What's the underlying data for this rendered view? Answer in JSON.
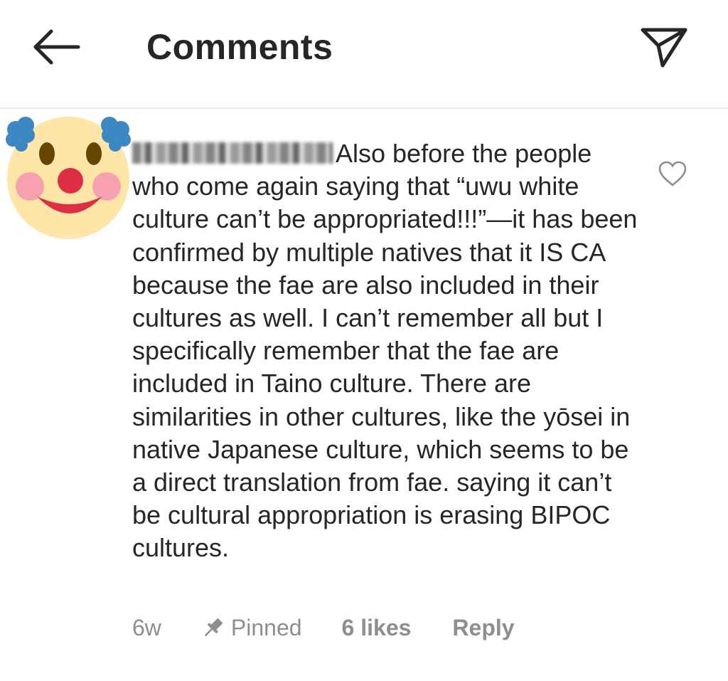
{
  "header": {
    "title": "Comments",
    "back_icon": "arrow-left-icon",
    "share_icon": "paper-plane-icon"
  },
  "comment": {
    "avatar_icon": "clown-face-icon",
    "text": "Also before the people who come again saying that “uwu white culture can’t be appropriated!!!”—it has been confirmed by multiple natives that it IS CA because the fae are also included in their cultures as well. I can’t remember all but I specifically remember that the fae are included in Taino culture. There are similarities in other cultures, like the yōsei in native Japanese culture, which seems to be a direct translation from fae. saying it can’t be cultural appropriation is erasing BIPOC cultures.",
    "like_icon": "heart-outline-icon",
    "time": "6w",
    "pinned_label": "Pinned",
    "pin_icon": "pin-icon",
    "likes": "6 likes",
    "reply_label": "Reply"
  },
  "colors": {
    "text": "#262626",
    "meta": "#8e8e8e",
    "divider": "#ececec",
    "avatar_face": "#fde6a8",
    "avatar_hair": "#3b88c3",
    "avatar_nose": "#dd2e44",
    "avatar_cheeks": "#f7a0b0"
  }
}
